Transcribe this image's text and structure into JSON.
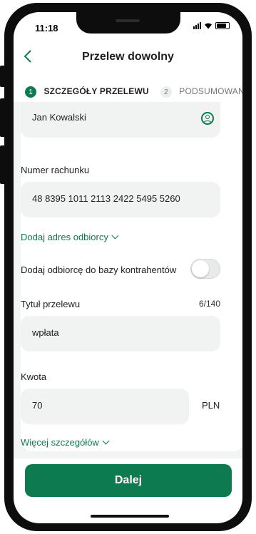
{
  "status_bar": {
    "time": "11:18"
  },
  "header": {
    "title": "Przelew dowolny",
    "back_icon": "chevron-left-icon"
  },
  "stepper": {
    "steps": [
      {
        "number": "1",
        "label": "SZCZEGÓŁY PRZELEWU",
        "active": true
      },
      {
        "number": "2",
        "label": "PODSUMOWANIE",
        "active": false
      }
    ]
  },
  "form": {
    "recipient": {
      "value": "Jan Kowalski",
      "icon": "contact-person-icon"
    },
    "account": {
      "label": "Numer rachunku",
      "value": "48 8395 1011 2113 2422 5495 5260"
    },
    "add_address_link": "Dodaj adres odbiorcy",
    "add_to_contacts": {
      "label": "Dodaj odbiorcę do bazy kontrahentów",
      "checked": false
    },
    "title": {
      "label": "Tytuł przelewu",
      "counter": "6/140",
      "value": "wpłata"
    },
    "amount": {
      "label": "Kwota",
      "value": "70",
      "currency": "PLN"
    },
    "more_details_link": "Więcej szczegółów"
  },
  "primary_button": {
    "label": "Dalej"
  },
  "colors": {
    "accent": "#0e7a4f",
    "field_bg": "#f1f2f2",
    "frame": "#0d0d0d"
  }
}
